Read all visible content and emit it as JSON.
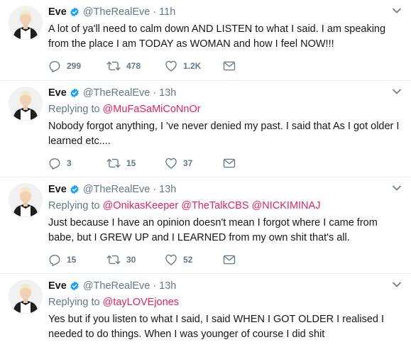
{
  "tweets": [
    {
      "name": "Eve",
      "handle": "@TheRealEve",
      "separator": "·",
      "time": "11h",
      "replying_label": "",
      "mentions": [],
      "text": "A lot of ya'll need to calm down AND LISTEN to what I said. I am speaking from the place I am TODAY as WOMAN and how I feel NOW!!!",
      "replies": "299",
      "retweets": "478",
      "likes": "1.2K"
    },
    {
      "name": "Eve",
      "handle": "@TheRealEve",
      "separator": "·",
      "time": "13h",
      "replying_label": "Replying to",
      "mentions": [
        "@MuFaSaMiCoNnOr"
      ],
      "text": "Nobody forgot anything, I 've never denied my past. I said that As I got older I learned etc....",
      "replies": "3",
      "retweets": "15",
      "likes": "37"
    },
    {
      "name": "Eve",
      "handle": "@TheRealEve",
      "separator": "·",
      "time": "13h",
      "replying_label": "Replying to",
      "mentions": [
        "@OnikasKeeper",
        "@TheTalkCBS",
        "@NICKIMINAJ"
      ],
      "text": "Just because I have an opinion doesn't mean I forgot where I came from babe, but I GREW UP and I LEARNED from my own shit that's all.",
      "replies": "15",
      "retweets": "30",
      "likes": "52"
    },
    {
      "name": "Eve",
      "handle": "@TheRealEve",
      "separator": "·",
      "time": "13h",
      "replying_label": "Replying to",
      "mentions": [
        "@tayLOVEjones"
      ],
      "text": "Yes but if you listen to what I said, I said WHEN I GOT OLDER I realised I needed to do things. When I was younger of course I did shit",
      "replies": "",
      "retweets": "",
      "likes": ""
    }
  ],
  "icons": {
    "verified": "verified-badge-icon",
    "caret": "chevron-down-icon",
    "reply": "reply-icon",
    "retweet": "retweet-icon",
    "like": "heart-icon",
    "message": "envelope-icon"
  },
  "colors": {
    "text": "#14171a",
    "secondary": "#657786",
    "mention": "#e0245e",
    "verified": "#1da1f2",
    "divider": "#e6ecf0"
  }
}
